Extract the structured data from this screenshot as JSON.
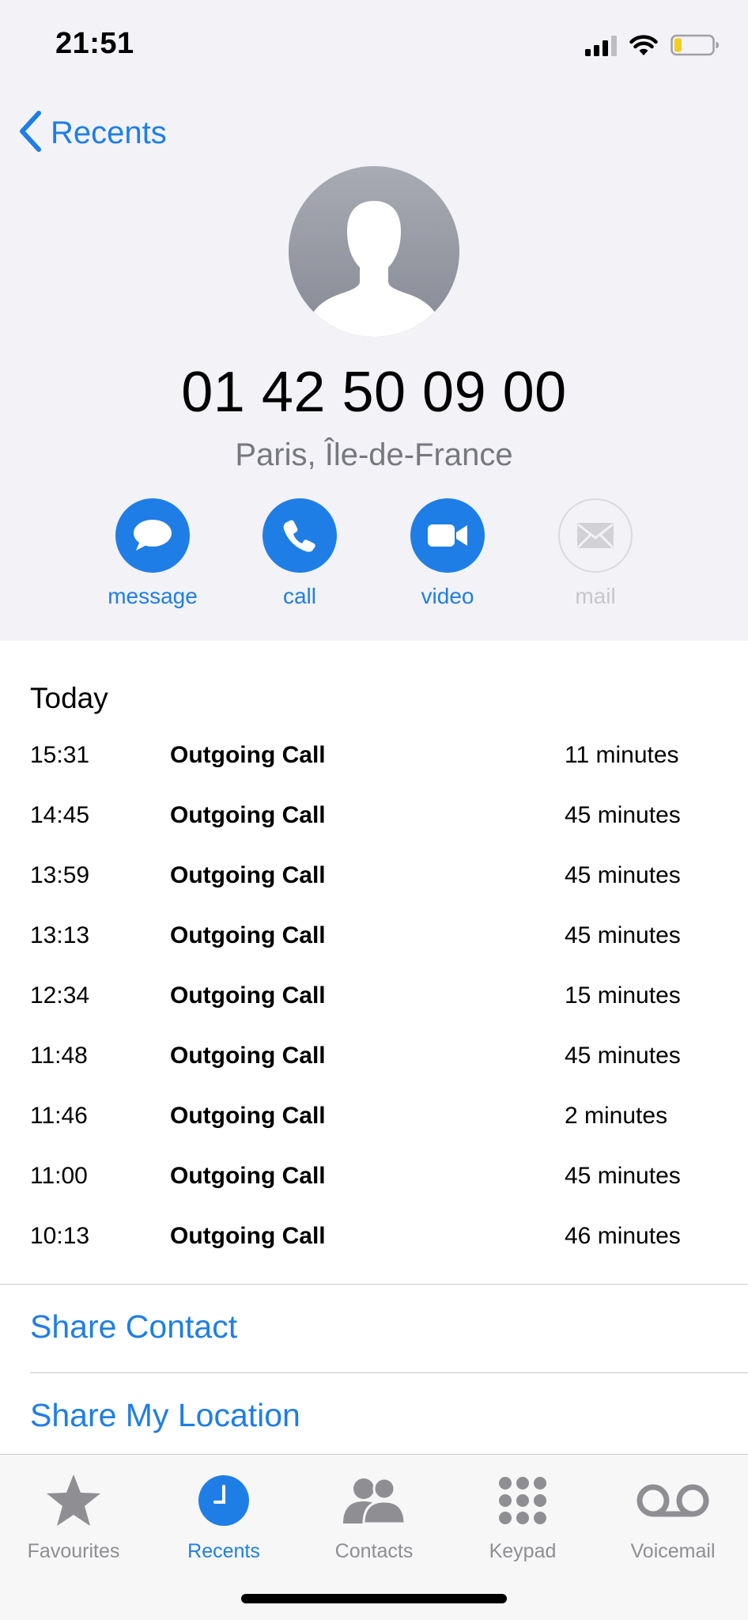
{
  "status_bar": {
    "time": "21:51"
  },
  "nav": {
    "back_label": "Recents"
  },
  "contact": {
    "phone_number": "01 42 50 09 00",
    "location": "Paris, Île-de-France"
  },
  "actions": [
    {
      "label": "message",
      "icon": "message-bubble-icon",
      "enabled": true
    },
    {
      "label": "call",
      "icon": "phone-icon",
      "enabled": true
    },
    {
      "label": "video",
      "icon": "video-camera-icon",
      "enabled": true
    },
    {
      "label": "mail",
      "icon": "envelope-icon",
      "enabled": false
    }
  ],
  "call_log": {
    "heading": "Today",
    "entries": [
      {
        "time": "15:31",
        "type": "Outgoing Call",
        "duration": "11 minutes"
      },
      {
        "time": "14:45",
        "type": "Outgoing Call",
        "duration": "45 minutes"
      },
      {
        "time": "13:59",
        "type": "Outgoing Call",
        "duration": "45 minutes"
      },
      {
        "time": "13:13",
        "type": "Outgoing Call",
        "duration": "45 minutes"
      },
      {
        "time": "12:34",
        "type": "Outgoing Call",
        "duration": "15 minutes"
      },
      {
        "time": "11:48",
        "type": "Outgoing Call",
        "duration": "45 minutes"
      },
      {
        "time": "11:46",
        "type": "Outgoing Call",
        "duration": "2 minutes"
      },
      {
        "time": "11:00",
        "type": "Outgoing Call",
        "duration": "45 minutes"
      },
      {
        "time": "10:13",
        "type": "Outgoing Call",
        "duration": "46 minutes"
      }
    ]
  },
  "links": {
    "share_contact": "Share Contact",
    "share_location": "Share My Location"
  },
  "tab_bar": {
    "active": "Recents",
    "tabs": [
      {
        "label": "Favourites",
        "icon": "star-icon"
      },
      {
        "label": "Recents",
        "icon": "clock-icon"
      },
      {
        "label": "Contacts",
        "icon": "people-icon"
      },
      {
        "label": "Keypad",
        "icon": "keypad-icon"
      },
      {
        "label": "Voicemail",
        "icon": "voicemail-icon"
      }
    ]
  },
  "colors": {
    "accent": "#1f7ee6",
    "header_background": "#f2f2f7",
    "secondary_text": "#8e8e93"
  }
}
